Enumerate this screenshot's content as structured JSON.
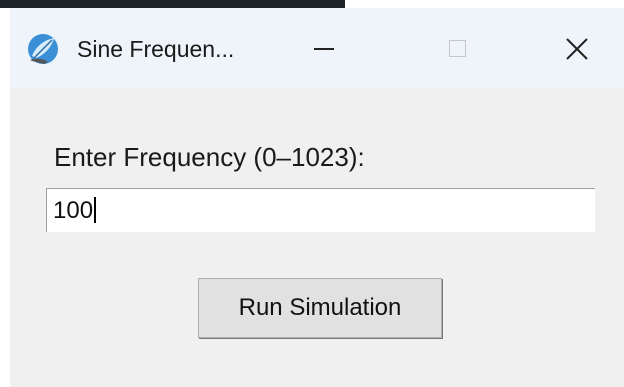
{
  "window": {
    "title": "Sine Frequen...",
    "icon": "app-feather-icon",
    "controls": {
      "minimize_icon": "minimize-icon",
      "maximize_icon": "maximize-icon",
      "close_icon": "close-icon"
    }
  },
  "form": {
    "label": "Enter Frequency (0–1023):",
    "frequency_value": "100",
    "run_label": "Run Simulation"
  },
  "colors": {
    "window_bg": "#f0f0f0",
    "titlebar_bg": "#eef4f9",
    "button_bg": "#e1e1e1"
  }
}
